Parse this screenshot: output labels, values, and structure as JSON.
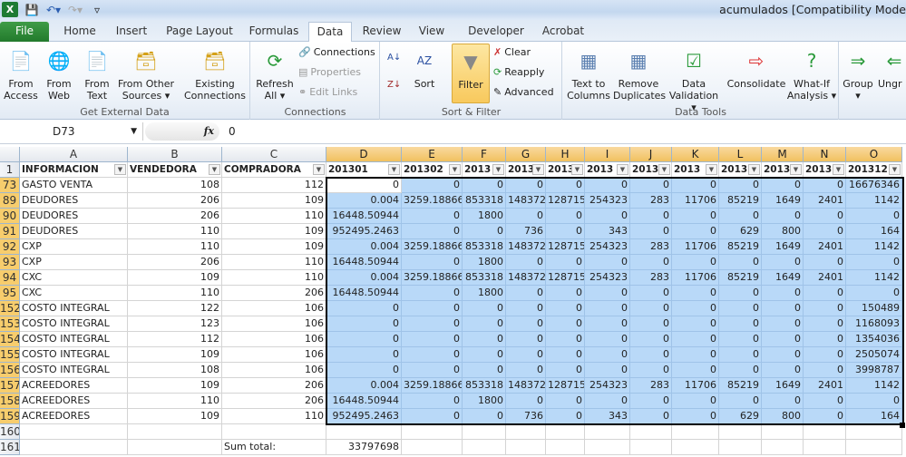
{
  "window": {
    "title": "acumulados  [Compatibility Mode"
  },
  "qat": {
    "app_icon": "excel-icon",
    "items": [
      "save-icon",
      "undo-icon",
      "redo-icon",
      "customize-icon"
    ]
  },
  "tabs": [
    "File",
    "Home",
    "Insert",
    "Page Layout",
    "Formulas",
    "Data",
    "Review",
    "View",
    "Developer",
    "Acrobat"
  ],
  "active_tab": "Data",
  "ribbon": {
    "get_external": {
      "label": "Get External Data",
      "buttons": [
        "From Access",
        "From Web",
        "From Text",
        "From Other Sources",
        "Existing Connections"
      ]
    },
    "connections": {
      "label": "Connections",
      "refresh": "Refresh All",
      "connections": "Connections",
      "properties": "Properties",
      "edit_links": "Edit Links"
    },
    "sort_filter": {
      "label": "Sort & Filter",
      "sort": "Sort",
      "filter": "Filter",
      "clear": "Clear",
      "reapply": "Reapply",
      "advanced": "Advanced"
    },
    "data_tools": {
      "label": "Data Tools",
      "text_to_columns": "Text to Columns",
      "remove_duplicates": "Remove Duplicates",
      "data_validation": "Data Validation",
      "consolidate": "Consolidate",
      "what_if": "What-If Analysis"
    },
    "outline": {
      "group": "Group",
      "ungroup": "Ungr"
    }
  },
  "formula_bar": {
    "name_box": "D73",
    "fx": "fx",
    "value": "0"
  },
  "columns": [
    "A",
    "B",
    "C",
    "D",
    "E",
    "F",
    "G",
    "H",
    "I",
    "J",
    "K",
    "L",
    "M",
    "N",
    "O"
  ],
  "header_row": {
    "num": "1",
    "cells": [
      "INFORMACION",
      "VENDEDORA",
      "COMPRADORA",
      "201301",
      "201302",
      "2013",
      "2013",
      "2013",
      "2013",
      "2013",
      "2013",
      "2013",
      "2013",
      "2013",
      "201312"
    ]
  },
  "rows": [
    {
      "num": "73",
      "cells": [
        "GASTO VENTA",
        "108",
        "112",
        "0",
        "0",
        "0",
        "0",
        "0",
        "0",
        "0",
        "0",
        "0",
        "0",
        "0",
        "16676346"
      ]
    },
    {
      "num": "89",
      "cells": [
        "DEUDORES",
        "206",
        "109",
        "0.004",
        "3259.18866",
        "853318",
        "148372",
        "128715",
        "254323",
        "283",
        "11706",
        "85219",
        "1649",
        "2401",
        "1142"
      ]
    },
    {
      "num": "90",
      "cells": [
        "DEUDORES",
        "206",
        "110",
        "16448.50944",
        "0",
        "1800",
        "0",
        "0",
        "0",
        "0",
        "0",
        "0",
        "0",
        "0",
        "0"
      ]
    },
    {
      "num": "91",
      "cells": [
        "DEUDORES",
        "110",
        "109",
        "952495.2463",
        "0",
        "0",
        "736",
        "0",
        "343",
        "0",
        "0",
        "629",
        "800",
        "0",
        "164"
      ]
    },
    {
      "num": "92",
      "cells": [
        "CXP",
        "110",
        "109",
        "0.004",
        "3259.18866",
        "853318",
        "148372",
        "128715",
        "254323",
        "283",
        "11706",
        "85219",
        "1649",
        "2401",
        "1142"
      ]
    },
    {
      "num": "93",
      "cells": [
        "CXP",
        "206",
        "110",
        "16448.50944",
        "0",
        "1800",
        "0",
        "0",
        "0",
        "0",
        "0",
        "0",
        "0",
        "0",
        "0"
      ]
    },
    {
      "num": "94",
      "cells": [
        "CXC",
        "109",
        "110",
        "0.004",
        "3259.18866",
        "853318",
        "148372",
        "128715",
        "254323",
        "283",
        "11706",
        "85219",
        "1649",
        "2401",
        "1142"
      ]
    },
    {
      "num": "95",
      "cells": [
        "CXC",
        "110",
        "206",
        "16448.50944",
        "0",
        "1800",
        "0",
        "0",
        "0",
        "0",
        "0",
        "0",
        "0",
        "0",
        "0"
      ]
    },
    {
      "num": "152",
      "cells": [
        "COSTO INTEGRAL",
        "122",
        "106",
        "0",
        "0",
        "0",
        "0",
        "0",
        "0",
        "0",
        "0",
        "0",
        "0",
        "0",
        "150489"
      ]
    },
    {
      "num": "153",
      "cells": [
        "COSTO INTEGRAL",
        "123",
        "106",
        "0",
        "0",
        "0",
        "0",
        "0",
        "0",
        "0",
        "0",
        "0",
        "0",
        "0",
        "1168093"
      ]
    },
    {
      "num": "154",
      "cells": [
        "COSTO INTEGRAL",
        "112",
        "106",
        "0",
        "0",
        "0",
        "0",
        "0",
        "0",
        "0",
        "0",
        "0",
        "0",
        "0",
        "1354036"
      ]
    },
    {
      "num": "155",
      "cells": [
        "COSTO INTEGRAL",
        "109",
        "106",
        "0",
        "0",
        "0",
        "0",
        "0",
        "0",
        "0",
        "0",
        "0",
        "0",
        "0",
        "2505074"
      ]
    },
    {
      "num": "156",
      "cells": [
        "COSTO INTEGRAL",
        "108",
        "106",
        "0",
        "0",
        "0",
        "0",
        "0",
        "0",
        "0",
        "0",
        "0",
        "0",
        "0",
        "3998787"
      ]
    },
    {
      "num": "157",
      "cells": [
        "ACREEDORES",
        "109",
        "206",
        "0.004",
        "3259.18866",
        "853318",
        "148372",
        "128715",
        "254323",
        "283",
        "11706",
        "85219",
        "1649",
        "2401",
        "1142"
      ]
    },
    {
      "num": "158",
      "cells": [
        "ACREEDORES",
        "110",
        "206",
        "16448.50944",
        "0",
        "1800",
        "0",
        "0",
        "0",
        "0",
        "0",
        "0",
        "0",
        "0",
        "0"
      ]
    },
    {
      "num": "159",
      "cells": [
        "ACREEDORES",
        "109",
        "110",
        "952495.2463",
        "0",
        "0",
        "736",
        "0",
        "343",
        "0",
        "0",
        "629",
        "800",
        "0",
        "164"
      ]
    },
    {
      "num": "160",
      "cells": [
        "",
        "",
        "",
        "",
        "",
        "",
        "",
        "",
        "",
        "",
        "",
        "",
        "",
        "",
        ""
      ]
    },
    {
      "num": "161",
      "cells": [
        "",
        "",
        "Sum total:",
        "33797698",
        "",
        "",
        "",
        "",
        "",
        "",
        "",
        "",
        "",
        "",
        ""
      ]
    }
  ],
  "colors": {
    "selection": "#b9d9f8",
    "file_tab": "#227a2c",
    "header_highlight": "#f7cd6d"
  }
}
